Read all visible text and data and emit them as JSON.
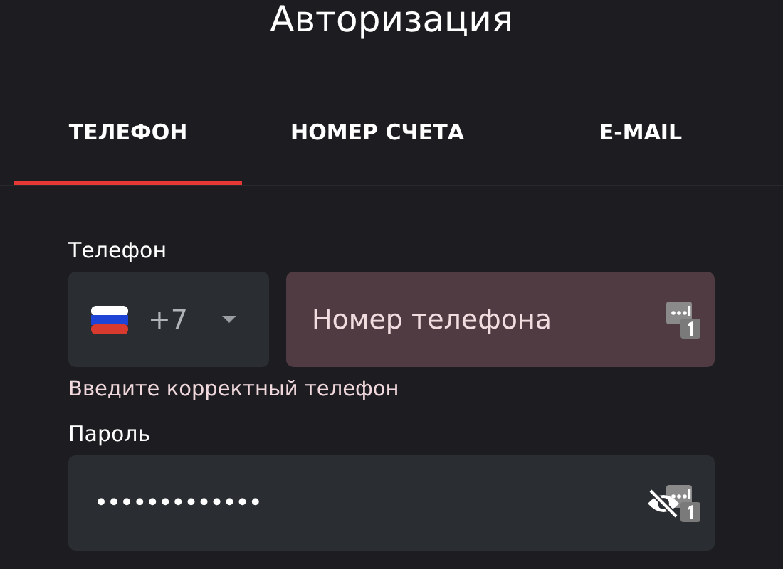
{
  "title": "Авторизация",
  "tabs": [
    {
      "label": "ТЕЛЕФОН",
      "selected": true
    },
    {
      "label": "НОМЕР СЧЕТА",
      "selected": false
    },
    {
      "label": "E-MAIL",
      "selected": false
    }
  ],
  "phone": {
    "label": "Телефон",
    "country_code": "+7",
    "placeholder": "Номер телефона",
    "invalid": true,
    "error": "Введите корректный телефон"
  },
  "password": {
    "label": "Пароль",
    "value": "•••••••••••••",
    "hidden": true
  }
}
